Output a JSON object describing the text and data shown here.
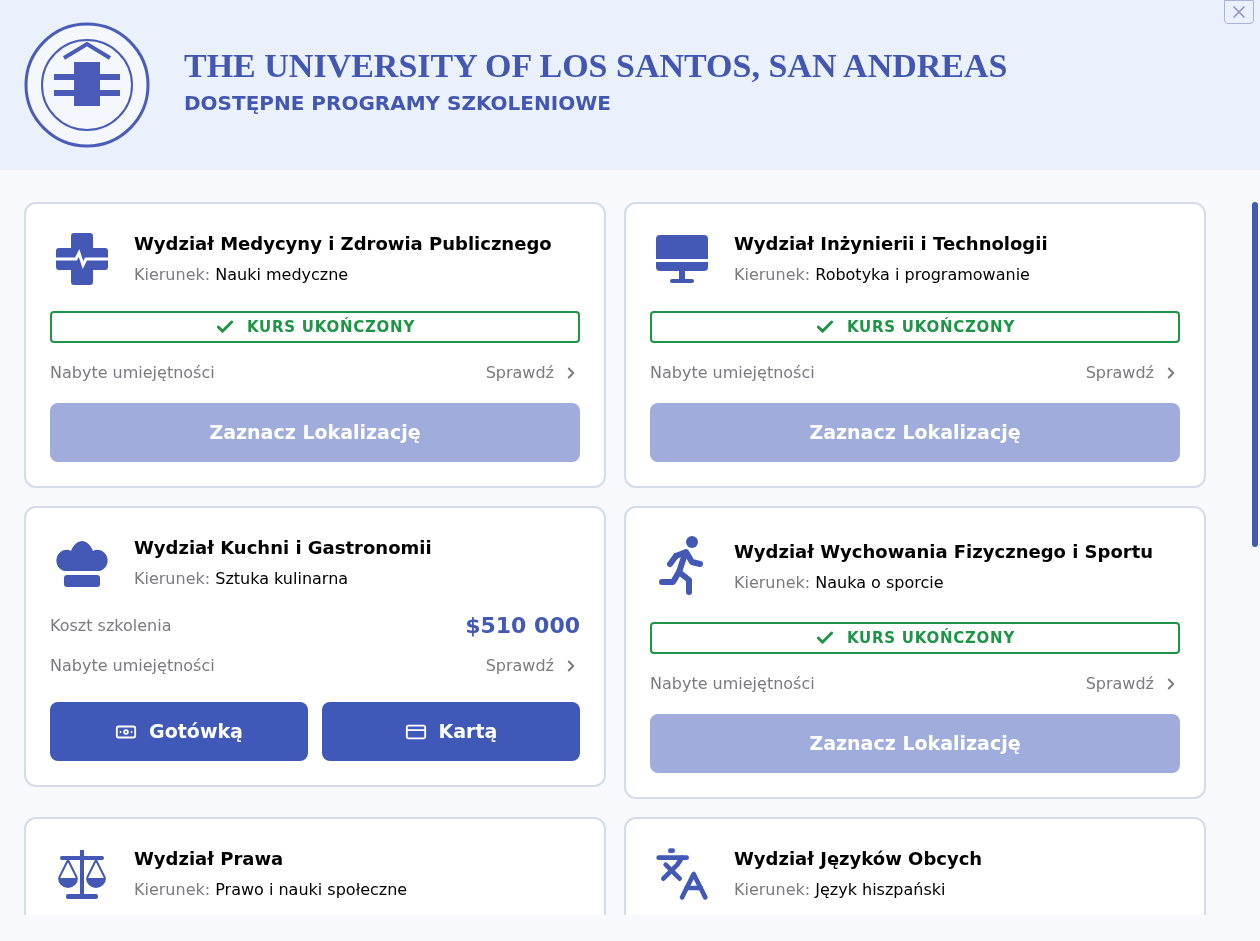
{
  "header": {
    "title": "THE UNIVERSITY OF LOS SANTOS, SAN ANDREAS",
    "subtitle": "DOSTĘPNE PROGRAMY SZKOLENIOWE"
  },
  "cards": [
    {
      "kind": "completed",
      "title": "Wydział Medycyny i Zdrowia Publicznego",
      "field_label": "Kierunek:",
      "field": "Nauki medyczne",
      "status": "KURS UKOŃCZONY",
      "skills_label": "Nabyte umiejętności",
      "skills_link": "Sprawdź",
      "button": "Zaznacz Lokalizację",
      "disabled": true
    },
    {
      "kind": "completed",
      "title": "Wydział Inżynierii i Technologii",
      "field_label": "Kierunek:",
      "field": "Robotyka i programowanie",
      "status": "KURS UKOŃCZONY",
      "skills_label": "Nabyte umiejętności",
      "skills_link": "Sprawdź",
      "button": "Zaznacz Lokalizację",
      "disabled": true
    },
    {
      "kind": "purchase",
      "title": "Wydział Kuchni i Gastronomii",
      "field_label": "Kierunek:",
      "field": "Sztuka kulinarna",
      "cost_label": "Koszt szkolenia",
      "cost": "$510 000",
      "skills_label": "Nabyte umiejętności",
      "skills_link": "Sprawdź",
      "pay_cash": "Gotówką",
      "pay_card": "Kartą"
    },
    {
      "kind": "completed",
      "title": "Wydział Wychowania Fizycznego i Sportu",
      "field_label": "Kierunek:",
      "field": "Nauka o sporcie",
      "status": "KURS UKOŃCZONY",
      "skills_label": "Nabyte umiejętności",
      "skills_link": "Sprawdź",
      "button": "Zaznacz Lokalizację",
      "disabled": true
    },
    {
      "kind": "partial",
      "title": "Wydział Prawa",
      "field_label": "Kierunek:",
      "field": "Prawo i nauki społeczne"
    },
    {
      "kind": "partial",
      "title": "Wydział Języków Obcych",
      "field_label": "Kierunek:",
      "field": "Język hiszpański"
    }
  ]
}
